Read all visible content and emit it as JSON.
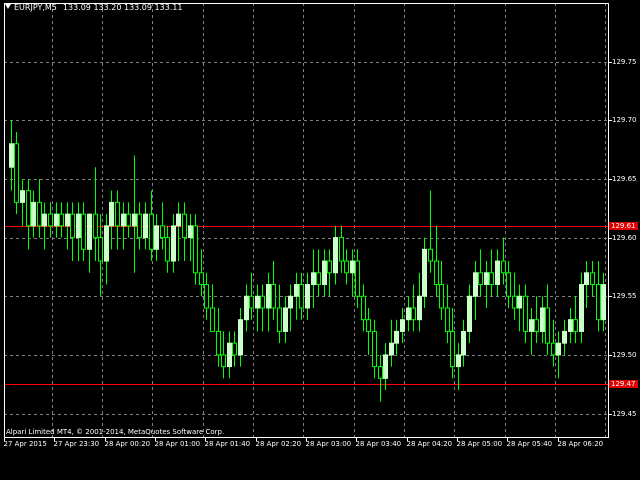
{
  "header": {
    "symbol": "EURJPY,M5",
    "ohlc": "133.09 133.20 133.09 133.11"
  },
  "copyright": "Alpari Limited MT4, © 2001-2014, MetaQuotes Software Corp.",
  "colors": {
    "background": "#000000",
    "grid": "#7f7f7f",
    "bull_body": "#ccffcc",
    "bear_body": "#000000",
    "wick": "#00ff00",
    "hline": "#ff0000",
    "axis": "#ffffff"
  },
  "hlines": [
    {
      "price": 129.61,
      "label": "129.61"
    },
    {
      "price": 129.475,
      "label": "129.47"
    }
  ],
  "chart_data": {
    "type": "candlestick",
    "ylim": [
      129.43,
      129.8
    ],
    "yticks": [
      {
        "v": 129.75,
        "label": "129.75"
      },
      {
        "v": 129.7,
        "label": "129.70"
      },
      {
        "v": 129.65,
        "label": "129.65"
      },
      {
        "v": 129.6,
        "label": "129.60"
      },
      {
        "v": 129.55,
        "label": "129.55"
      },
      {
        "v": 129.5,
        "label": "129.50"
      },
      {
        "v": 129.45,
        "label": "129.45"
      }
    ],
    "xticks": [
      "27 Apr 2015",
      "27 Apr 23:30",
      "28 Apr 00:20",
      "28 Apr 01:00",
      "28 Apr 01:40",
      "28 Apr 02:20",
      "28 Apr 03:00",
      "28 Apr 03:40",
      "28 Apr 04:20",
      "28 Apr 05:00",
      "28 Apr 05:40",
      "28 Apr 06:20"
    ],
    "candles": [
      [
        129.66,
        129.7,
        129.64,
        129.68
      ],
      [
        129.68,
        129.69,
        129.62,
        129.63
      ],
      [
        129.63,
        129.65,
        129.61,
        129.64
      ],
      [
        129.64,
        129.65,
        129.59,
        129.61
      ],
      [
        129.61,
        129.64,
        129.6,
        129.63
      ],
      [
        129.63,
        129.65,
        129.6,
        129.61
      ],
      [
        129.61,
        129.63,
        129.59,
        129.62
      ],
      [
        129.62,
        129.63,
        129.6,
        129.61
      ],
      [
        129.61,
        129.63,
        129.6,
        129.62
      ],
      [
        129.62,
        129.63,
        129.6,
        129.61
      ],
      [
        129.61,
        129.63,
        129.59,
        129.62
      ],
      [
        129.62,
        129.63,
        129.58,
        129.6
      ],
      [
        129.6,
        129.63,
        129.58,
        129.62
      ],
      [
        129.62,
        129.63,
        129.58,
        129.59
      ],
      [
        129.59,
        129.62,
        129.57,
        129.62
      ],
      [
        129.62,
        129.66,
        129.58,
        129.6
      ],
      [
        129.6,
        129.62,
        129.55,
        129.58
      ],
      [
        129.58,
        129.62,
        129.56,
        129.61
      ],
      [
        129.61,
        129.64,
        129.59,
        129.63
      ],
      [
        129.63,
        129.64,
        129.59,
        129.61
      ],
      [
        129.61,
        129.63,
        129.59,
        129.62
      ],
      [
        129.62,
        129.63,
        129.6,
        129.61
      ],
      [
        129.61,
        129.67,
        129.57,
        129.62
      ],
      [
        129.62,
        129.63,
        129.59,
        129.6
      ],
      [
        129.6,
        129.63,
        129.59,
        129.62
      ],
      [
        129.62,
        129.64,
        129.58,
        129.59
      ],
      [
        129.59,
        129.62,
        129.58,
        129.61
      ],
      [
        129.61,
        129.63,
        129.59,
        129.6
      ],
      [
        129.6,
        129.61,
        129.57,
        129.58
      ],
      [
        129.58,
        129.62,
        129.57,
        129.61
      ],
      [
        129.61,
        129.63,
        129.58,
        129.62
      ],
      [
        129.62,
        129.63,
        129.58,
        129.6
      ],
      [
        129.6,
        129.62,
        129.58,
        129.61
      ],
      [
        129.61,
        129.62,
        129.56,
        129.57
      ],
      [
        129.57,
        129.59,
        129.55,
        129.56
      ],
      [
        129.56,
        129.57,
        129.53,
        129.54
      ],
      [
        129.54,
        129.56,
        129.52,
        129.52
      ],
      [
        129.52,
        129.54,
        129.49,
        129.5
      ],
      [
        129.5,
        129.52,
        129.48,
        129.49
      ],
      [
        129.49,
        129.52,
        129.48,
        129.51
      ],
      [
        129.51,
        129.52,
        129.49,
        129.5
      ],
      [
        129.5,
        129.54,
        129.49,
        129.53
      ],
      [
        129.53,
        129.56,
        129.52,
        129.55
      ],
      [
        129.55,
        129.57,
        129.53,
        129.54
      ],
      [
        129.54,
        129.56,
        129.52,
        129.55
      ],
      [
        129.55,
        129.56,
        129.52,
        129.54
      ],
      [
        129.54,
        129.57,
        129.52,
        129.56
      ],
      [
        129.56,
        129.58,
        129.53,
        129.54
      ],
      [
        129.54,
        129.56,
        129.51,
        129.52
      ],
      [
        129.52,
        129.55,
        129.51,
        129.54
      ],
      [
        129.54,
        129.56,
        129.52,
        129.55
      ],
      [
        129.55,
        129.57,
        129.53,
        129.56
      ],
      [
        129.56,
        129.57,
        129.53,
        129.54
      ],
      [
        129.54,
        129.57,
        129.53,
        129.56
      ],
      [
        129.56,
        129.59,
        129.54,
        129.57
      ],
      [
        129.57,
        129.59,
        129.55,
        129.56
      ],
      [
        129.56,
        129.59,
        129.55,
        129.58
      ],
      [
        129.58,
        129.59,
        129.55,
        129.57
      ],
      [
        129.57,
        129.61,
        129.56,
        129.6
      ],
      [
        129.6,
        129.61,
        129.57,
        129.58
      ],
      [
        129.58,
        129.59,
        129.56,
        129.57
      ],
      [
        129.57,
        129.59,
        129.55,
        129.58
      ],
      [
        129.58,
        129.59,
        129.54,
        129.55
      ],
      [
        129.55,
        129.56,
        129.52,
        129.53
      ],
      [
        129.53,
        129.54,
        129.5,
        129.52
      ],
      [
        129.52,
        129.53,
        129.48,
        129.49
      ],
      [
        129.49,
        129.5,
        129.46,
        129.48
      ],
      [
        129.48,
        129.51,
        129.47,
        129.5
      ],
      [
        129.5,
        129.53,
        129.49,
        129.51
      ],
      [
        129.51,
        129.53,
        129.5,
        129.52
      ],
      [
        129.52,
        129.54,
        129.51,
        129.53
      ],
      [
        129.53,
        129.55,
        129.52,
        129.54
      ],
      [
        129.54,
        129.56,
        129.52,
        129.53
      ],
      [
        129.53,
        129.57,
        129.52,
        129.55
      ],
      [
        129.55,
        129.6,
        129.54,
        129.59
      ],
      [
        129.59,
        129.64,
        129.57,
        129.58
      ],
      [
        129.58,
        129.61,
        129.55,
        129.56
      ],
      [
        129.56,
        129.58,
        129.53,
        129.54
      ],
      [
        129.54,
        129.56,
        129.51,
        129.52
      ],
      [
        129.52,
        129.54,
        129.48,
        129.49
      ],
      [
        129.49,
        129.51,
        129.47,
        129.5
      ],
      [
        129.5,
        129.53,
        129.49,
        129.52
      ],
      [
        129.52,
        129.56,
        129.51,
        129.55
      ],
      [
        129.55,
        129.58,
        129.53,
        129.57
      ],
      [
        129.57,
        129.59,
        129.55,
        129.56
      ],
      [
        129.56,
        129.58,
        129.54,
        129.57
      ],
      [
        129.57,
        129.59,
        129.55,
        129.56
      ],
      [
        129.56,
        129.59,
        129.55,
        129.58
      ],
      [
        129.58,
        129.6,
        129.56,
        129.57
      ],
      [
        129.57,
        129.58,
        129.54,
        129.55
      ],
      [
        129.55,
        129.57,
        129.53,
        129.54
      ],
      [
        129.54,
        129.56,
        129.52,
        129.55
      ],
      [
        129.55,
        129.56,
        129.51,
        129.52
      ],
      [
        129.52,
        129.54,
        129.5,
        129.53
      ],
      [
        129.53,
        129.55,
        129.51,
        129.52
      ],
      [
        129.52,
        129.55,
        129.51,
        129.54
      ],
      [
        129.54,
        129.56,
        129.5,
        129.51
      ],
      [
        129.51,
        129.53,
        129.49,
        129.5
      ],
      [
        129.5,
        129.52,
        129.48,
        129.51
      ],
      [
        129.51,
        129.53,
        129.5,
        129.52
      ],
      [
        129.52,
        129.54,
        129.51,
        129.53
      ],
      [
        129.53,
        129.55,
        129.51,
        129.52
      ],
      [
        129.52,
        129.57,
        129.51,
        129.56
      ],
      [
        129.56,
        129.58,
        129.54,
        129.57
      ],
      [
        129.57,
        129.58,
        129.55,
        129.56
      ],
      [
        129.56,
        129.58,
        129.52,
        129.53
      ],
      [
        129.53,
        129.57,
        129.52,
        129.56
      ]
    ]
  }
}
